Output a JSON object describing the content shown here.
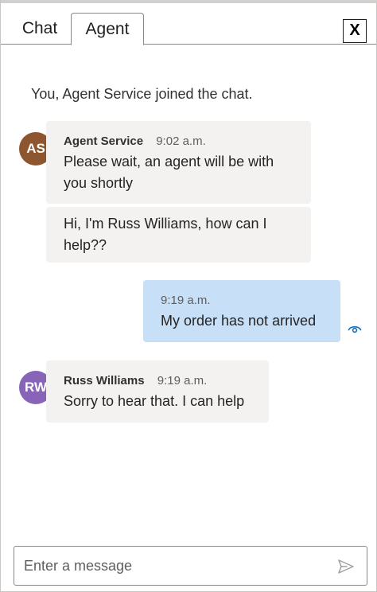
{
  "tabs": [
    {
      "label": "Chat",
      "active": false
    },
    {
      "label": "Agent",
      "active": true
    }
  ],
  "close_label": "X",
  "system_message": "You, Agent Service joined the chat.",
  "messages": [
    {
      "sender": "Agent Service",
      "initials": "AS",
      "avatar_color": "#8e562e",
      "time": "9:02 a.m.",
      "texts": [
        "Please wait, an agent will be with you shortly",
        "Hi, I'm Russ Williams, how can I help??"
      ]
    },
    {
      "sender": "",
      "time": "9:19 a.m.",
      "is_self": true,
      "bubble_color": "#c7dff7",
      "text": "My order has not arrived",
      "status_icon": "read-eye-icon"
    },
    {
      "sender": "Russ Williams",
      "initials": "RW",
      "avatar_color": "#8764b8",
      "time": "9:19 a.m.",
      "text": "Sorry to hear that. I can help"
    }
  ],
  "composer": {
    "placeholder": "Enter a message",
    "send_icon": "send-icon"
  },
  "colors": {
    "accent": "#0f6cbd",
    "agent_bubble": "#f3f2f1",
    "user_bubble": "#c7dff7"
  }
}
